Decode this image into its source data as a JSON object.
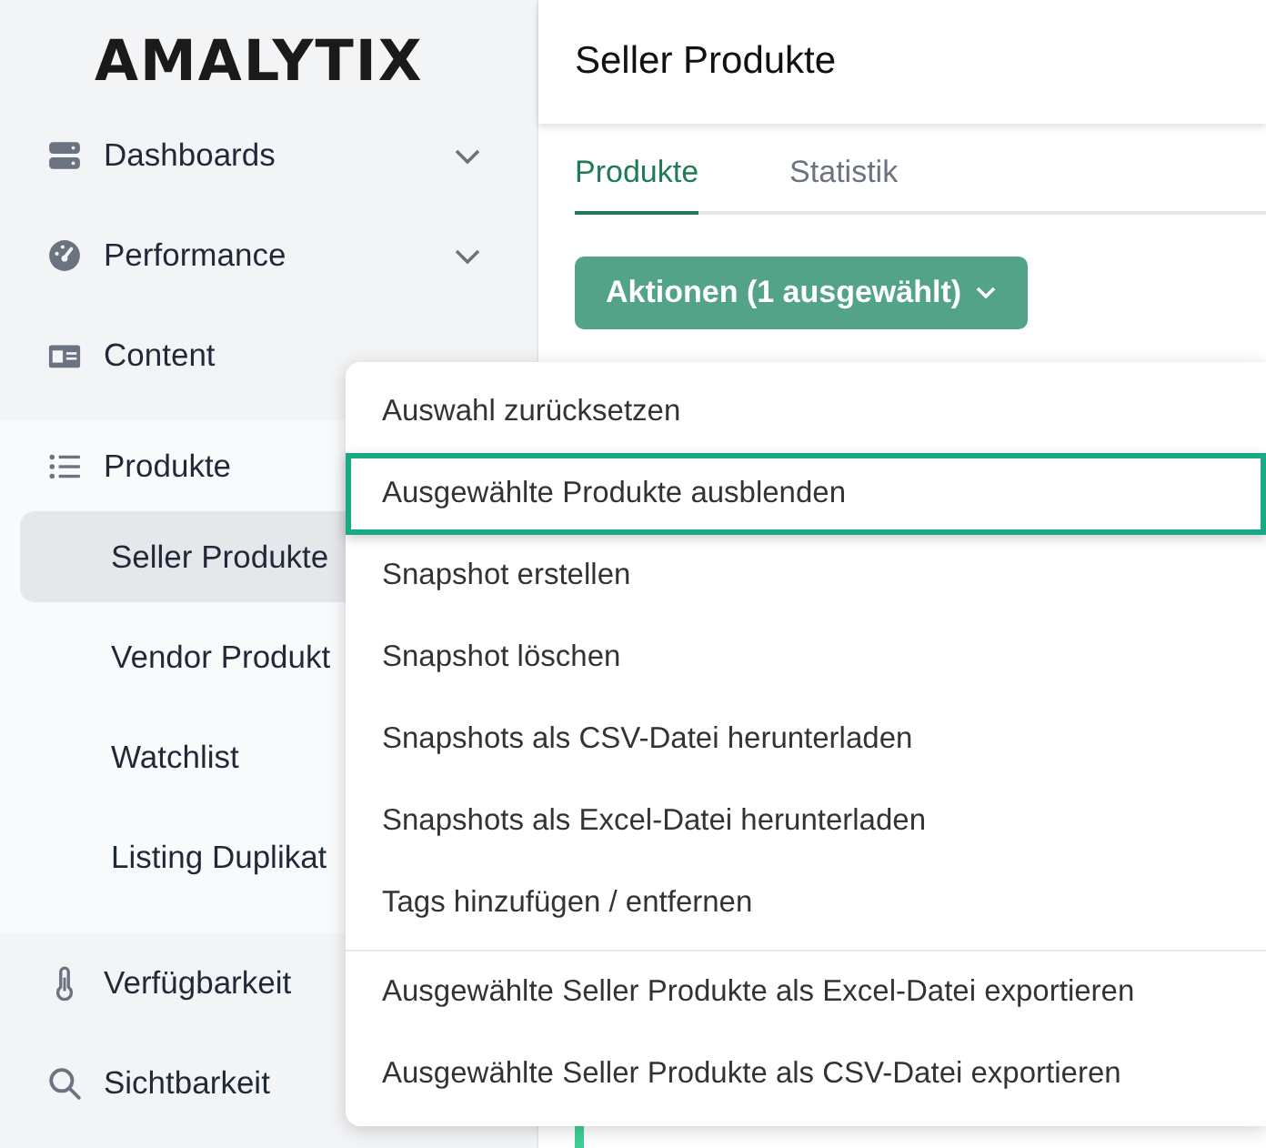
{
  "logo": "AMALYTIX",
  "sidebar": {
    "items": [
      {
        "label": "Dashboards",
        "kind": "server",
        "chevron": true,
        "expanded": false
      },
      {
        "label": "Performance",
        "kind": "gauge",
        "chevron": true,
        "expanded": false
      },
      {
        "label": "Content",
        "kind": "card",
        "chevron": false,
        "expanded": false
      },
      {
        "label": "Produkte",
        "kind": "list",
        "chevron": false,
        "expanded": true,
        "children": [
          {
            "label": "Seller Produkte",
            "selected": true
          },
          {
            "label": "Vendor Produkt",
            "selected": false
          },
          {
            "label": "Watchlist",
            "selected": false
          },
          {
            "label": "Listing Duplikat",
            "selected": false
          }
        ]
      },
      {
        "label": "Verfügbarkeit",
        "kind": "thermometer",
        "chevron": false,
        "expanded": false
      },
      {
        "label": "Sichtbarkeit",
        "kind": "search",
        "chevron": false,
        "expanded": false
      }
    ]
  },
  "page_title": "Seller Produkte",
  "tabs": [
    {
      "label": "Produkte",
      "selected": true
    },
    {
      "label": "Statistik",
      "selected": false
    }
  ],
  "actions_button": "Aktionen (1 ausgewählt)",
  "menu": {
    "groups": [
      [
        {
          "label": "Auswahl zurücksetzen",
          "selected": false
        },
        {
          "label": "Ausgewählte Produkte ausblenden",
          "selected": true
        },
        {
          "label": "Snapshot erstellen",
          "selected": false
        },
        {
          "label": "Snapshot löschen",
          "selected": false
        },
        {
          "label": "Snapshots als CSV-Datei herunterladen",
          "selected": false
        },
        {
          "label": "Snapshots als Excel-Datei herunterladen",
          "selected": false
        },
        {
          "label": "Tags hinzufügen / entfernen",
          "selected": false
        }
      ],
      [
        {
          "label": "Ausgewählte Seller Produkte als Excel-Datei exportieren",
          "selected": false
        },
        {
          "label": "Ausgewählte Seller Produkte als CSV-Datei exportieren",
          "selected": false
        }
      ]
    ]
  }
}
